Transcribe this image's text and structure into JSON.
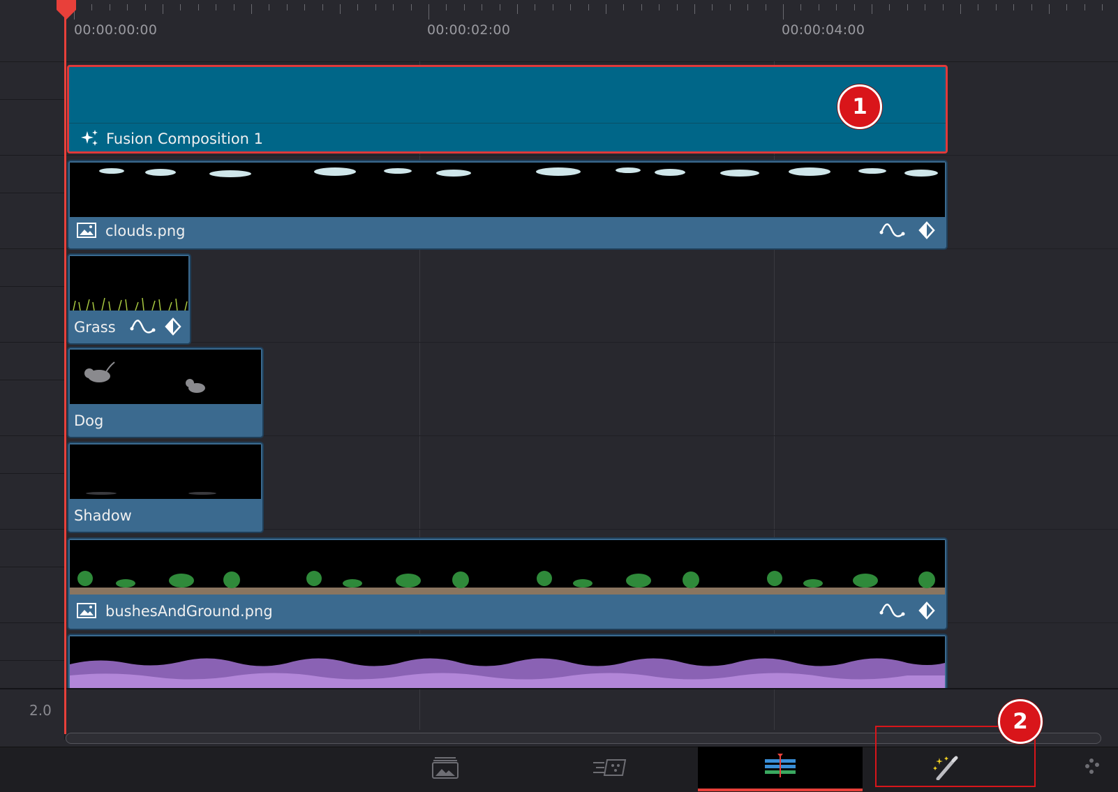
{
  "ruler": {
    "timecodes": [
      "00:00:00:00",
      "00:00:02:00",
      "00:00:04:00"
    ]
  },
  "tracks": {
    "fusion_label": "Fusion Composition 1",
    "clouds_label": "clouds.png",
    "grass_label": "Grass",
    "dog_label": "Dog",
    "shadow_label": "Shadow",
    "bushes_label": "bushesAndGround.png"
  },
  "audio": {
    "channel_label": "2.0"
  },
  "annotations": {
    "badge_1": "1",
    "badge_2": "2"
  },
  "page_tabs": [
    {
      "name": "media-page",
      "icon": "image-stack-icon"
    },
    {
      "name": "cut-page",
      "icon": "cut-page-icon"
    },
    {
      "name": "edit-page",
      "icon": "timeline-edit-icon",
      "active": true
    },
    {
      "name": "fusion-page",
      "icon": "magic-wand-icon"
    },
    {
      "name": "color-page",
      "icon": "color-dots-icon"
    }
  ],
  "colors": {
    "playhead": "#e8403a",
    "fusion_clip": "#006688",
    "video_clip": "#3b6a8f",
    "annotation": "#d9151a"
  }
}
